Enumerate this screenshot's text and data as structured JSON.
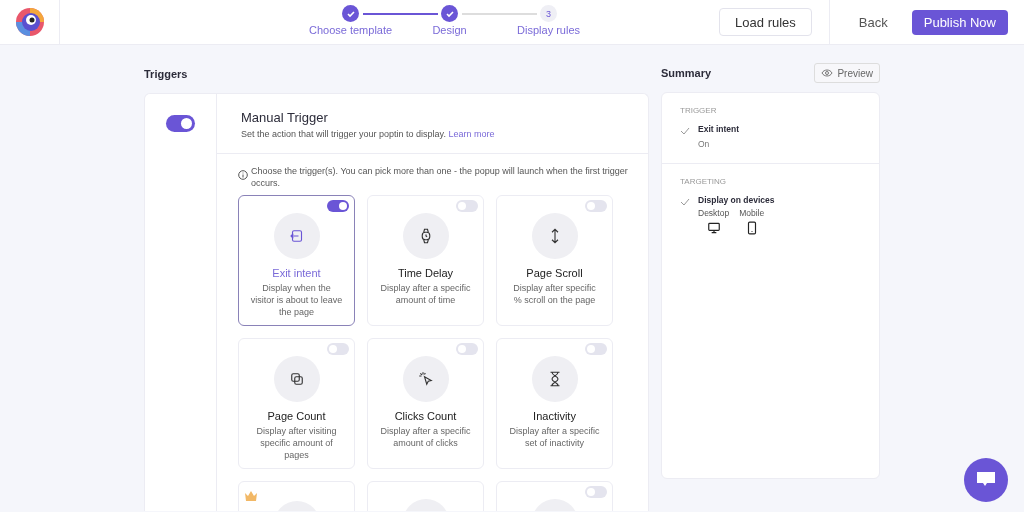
{
  "header": {
    "steps": [
      {
        "label": "Choose template",
        "done": true
      },
      {
        "label": "Design",
        "done": true
      },
      {
        "label": "Display rules",
        "number": "3",
        "done": false
      }
    ],
    "buttons": {
      "load": "Load rules",
      "back": "Back",
      "publish": "Publish Now"
    }
  },
  "triggers": {
    "title": "Triggers",
    "manual": {
      "on": true,
      "title": "Manual Trigger",
      "description": "Set the action that will trigger your poptin to display.",
      "link": "Learn more"
    },
    "hint": "Choose the trigger(s). You can pick more than one - the popup will launch when the first trigger occurs.",
    "cards": [
      {
        "kind": "full",
        "title": "Exit intent",
        "description": "Display when the visitor is about to leave the page",
        "on": true
      },
      {
        "kind": "full",
        "title": "Time Delay",
        "description": "Display after a specific amount of time",
        "on": false
      },
      {
        "kind": "full",
        "title": "Page Scroll",
        "description": "Display after specific % scroll on the page",
        "on": false
      },
      {
        "kind": "full",
        "title": "Page Count",
        "description": "Display after visiting specific amount of pages",
        "on": false
      },
      {
        "kind": "full",
        "title": "Clicks Count",
        "description": "Display after a specific amount of clicks",
        "on": false
      },
      {
        "kind": "full",
        "title": "Inactivity",
        "description": "Display after a specific set of inactivity",
        "on": false
      },
      {
        "kind": "premium"
      },
      {
        "kind": "blank"
      },
      {
        "kind": "partial",
        "on": false
      }
    ]
  },
  "summary": {
    "title": "Summary",
    "preview": "Preview",
    "sections": [
      {
        "heading": "TRIGGER",
        "item": "Exit intent",
        "detail": "On"
      },
      {
        "heading": "TARGETING",
        "item": "Display on devices",
        "devices": [
          {
            "label": "Desktop"
          },
          {
            "label": "Mobile"
          }
        ]
      }
    ]
  }
}
